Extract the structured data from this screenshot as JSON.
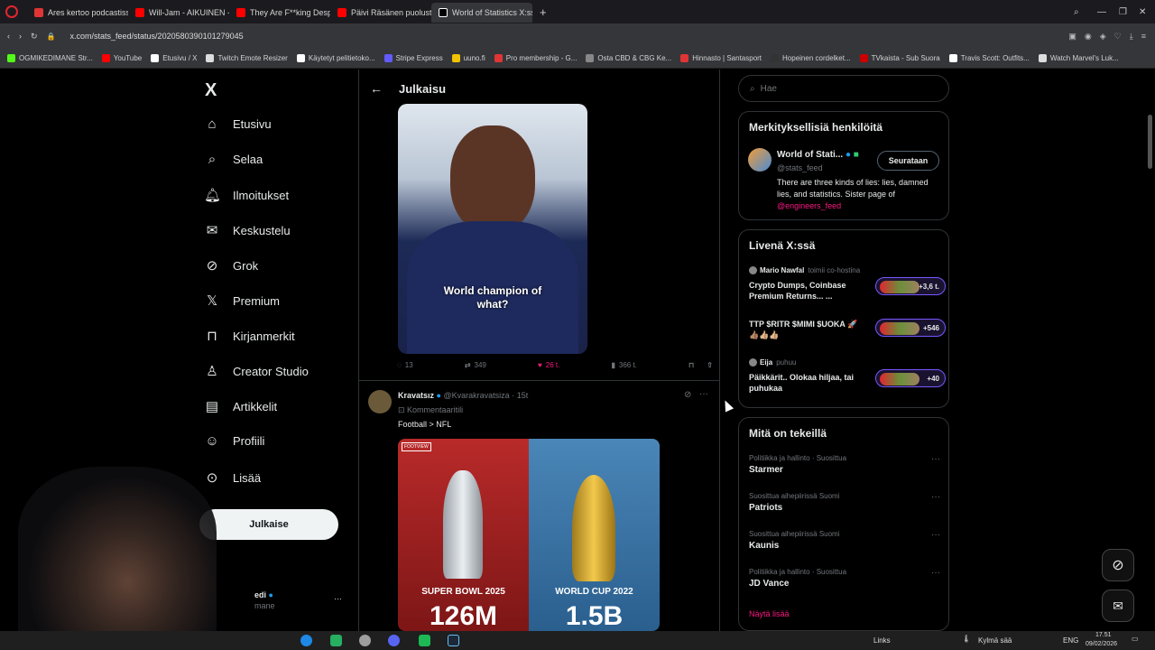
{
  "browser": {
    "tabs": [
      {
        "label": "Ares kertoo podcastissa v",
        "color": "#e03535"
      },
      {
        "label": "Will-Jam - AIKUINEN - Yo",
        "color": "#ff0000"
      },
      {
        "label": "They Are F**king Desperat",
        "color": "#ff0000"
      },
      {
        "label": "Päivi Räsänen puolustaa k",
        "color": "#ff0000"
      },
      {
        "label": "World of Statistics X:ssä:",
        "color": "#ffffff"
      }
    ],
    "url": "x.com/stats_feed/status/2020580390101279045",
    "bookmarks": [
      {
        "label": "OGMIKEDIMANE Str...",
        "color": "#53fc18"
      },
      {
        "label": "YouTube",
        "color": "#ff0000"
      },
      {
        "label": "Etusivu / X",
        "color": "#ffffff"
      },
      {
        "label": "Twitch Emote Resizer",
        "color": "#dddddd"
      },
      {
        "label": "Käytetyt pelitietoko...",
        "color": "#ffffff"
      },
      {
        "label": "Stripe Express",
        "color": "#635bff"
      },
      {
        "label": "uuno.fi",
        "color": "#f2c300"
      },
      {
        "label": "Pro membership - G...",
        "color": "#e03535"
      },
      {
        "label": "Osta CBD & CBG Ke...",
        "color": "#888888"
      },
      {
        "label": "Hinnasto | Santasport",
        "color": "#e03535"
      },
      {
        "label": "Hopeinen cordelket...",
        "color": "#333333"
      },
      {
        "label": "TVkaista - Sub Suora",
        "color": "#cc0000"
      },
      {
        "label": "Travis Scott: Outfits...",
        "color": "#ffffff"
      },
      {
        "label": "Watch Marvel's Luk...",
        "color": "#dddddd"
      }
    ]
  },
  "nav": {
    "logo": "X",
    "items": [
      {
        "label": "Etusivu",
        "icon": "home-icon"
      },
      {
        "label": "Selaa",
        "icon": "search-icon"
      },
      {
        "label": "Ilmoitukset",
        "icon": "bell-icon"
      },
      {
        "label": "Keskustelu",
        "icon": "mail-icon"
      },
      {
        "label": "Grok",
        "icon": "grok-icon"
      },
      {
        "label": "Premium",
        "icon": "x-icon"
      },
      {
        "label": "Kirjanmerkit",
        "icon": "bookmark-icon"
      },
      {
        "label": "Creator Studio",
        "icon": "creator-icon"
      },
      {
        "label": "Artikkelit",
        "icon": "article-icon"
      },
      {
        "label": "Profiili",
        "icon": "profile-icon"
      },
      {
        "label": "Lisää",
        "icon": "more-icon"
      }
    ],
    "post_button": "Julkaise",
    "account_name": "edi",
    "account_handle": "mane"
  },
  "main": {
    "header": "Julkaisu",
    "video_caption_line1": "World champion of",
    "video_caption_line2": "what?",
    "stats": {
      "replies": "13",
      "reposts": "349",
      "likes": "26 t.",
      "views": "366 t."
    },
    "reply": {
      "name": "Kravatsız",
      "handle": "@Kvarakravatsiza",
      "time": "15t",
      "note": "Kommentaaritili",
      "text": "Football > NFL",
      "image_left_label": "SUPER BOWL 2025",
      "image_right_label": "WORLD CUP 2022",
      "image_left_value": "126M",
      "image_right_value": "1.5B",
      "image_badge": "FOOTVIEW"
    }
  },
  "sidebar": {
    "search_placeholder": "Hae",
    "relevant": {
      "title": "Merkityksellisiä henkilöitä",
      "name": "World of Stati...",
      "handle": "@stats_feed",
      "follow": "Seurataan",
      "bio": "There are three kinds of lies: lies, damned lies, and statistics. Sister page of",
      "bio_link": "@engineers_feed"
    },
    "live": {
      "title": "Livenä X:ssä",
      "items": [
        {
          "host": "Mario Nawfal",
          "role": "toimii co-hostina",
          "title": "Crypto Dumps, Coinbase Premium Returns... ...",
          "count": "+3,6 t."
        },
        {
          "host": "",
          "role": "",
          "title": "TTP $RITR $MIMI $UOKA 🚀👍🏽👍🏼👍🏼",
          "count": "+546"
        },
        {
          "host": "Eija",
          "role": "puhuu",
          "title": "Päikkärit.. Olokaa hiljaa, tai puhukaa",
          "count": "+40"
        }
      ]
    },
    "trends": {
      "title": "Mitä on tekeillä",
      "items": [
        {
          "meta": "Politiikka ja hallinto · Suosittua",
          "name": "Starmer"
        },
        {
          "meta": "Suosittua aihepiirissä Suomi",
          "name": "Patriots"
        },
        {
          "meta": "Suosittua aihepiirissä Suomi",
          "name": "Kaunis"
        },
        {
          "meta": "Politiikka ja hallinto · Suosittua",
          "name": "JD Vance"
        }
      ],
      "show_more": "Näytä lisää"
    }
  },
  "taskbar": {
    "links": "Links",
    "weather": "Kylmä sää",
    "lang": "ENG",
    "time": "17.51",
    "date": "09/02/2026"
  }
}
